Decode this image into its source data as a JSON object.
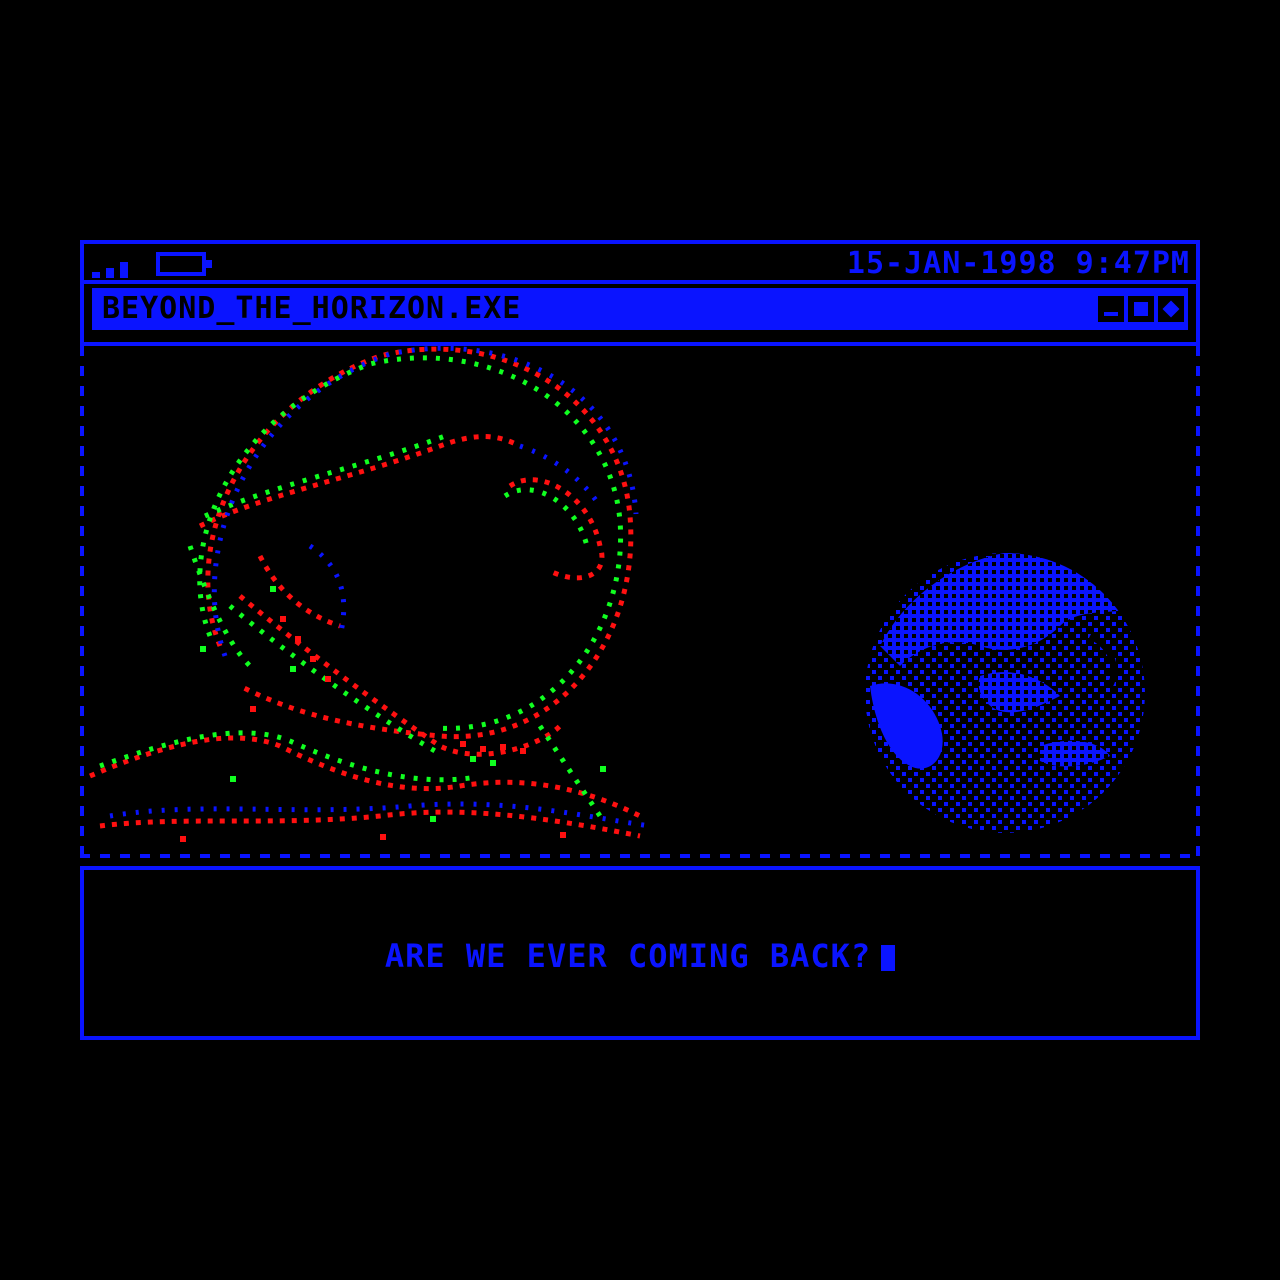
{
  "status_bar": {
    "signal_icon": "signal-bars-icon",
    "battery_icon": "battery-icon",
    "datetime": "15-JAN-1998 9:47PM"
  },
  "window": {
    "title": "BEYOND_THE_HORIZON.EXE",
    "controls": [
      "minimize-icon",
      "maximize-icon",
      "close-icon"
    ]
  },
  "scene": {
    "subject": "astronaut-helmet-illustration",
    "planet": "earth-illustration"
  },
  "dialog": {
    "message": "ARE WE EVER COMING BACK?"
  },
  "colors": {
    "accent": "#0a14ff",
    "background": "#000000",
    "glitch_red": "#ff1010",
    "glitch_green": "#10ff20"
  }
}
